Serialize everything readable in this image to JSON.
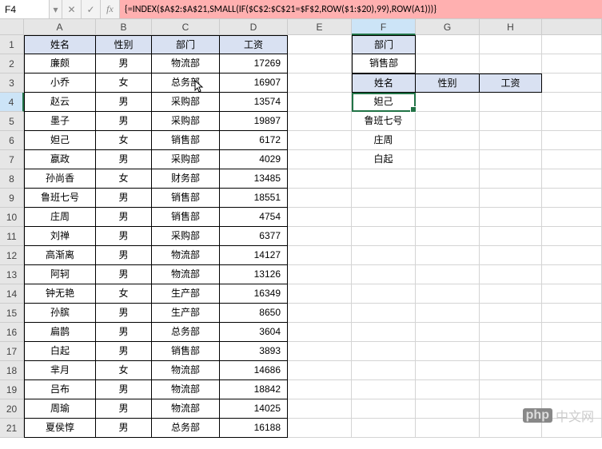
{
  "namebox": "F4",
  "formula": "{=INDEX($A$2:$A$21,SMALL(IF($C$2:$C$21=$F$2,ROW($1:$20),99),ROW(A1)))}",
  "fx_label": "fx",
  "cancel_icon": "✕",
  "confirm_icon": "✓",
  "dropdown_icon": "▾",
  "columns": [
    "A",
    "B",
    "C",
    "D",
    "E",
    "F",
    "G",
    "H",
    ""
  ],
  "main_headers": [
    "姓名",
    "性别",
    "部门",
    "工资"
  ],
  "main_rows": [
    [
      "廉颇",
      "男",
      "物流部",
      "17269"
    ],
    [
      "小乔",
      "女",
      "总务部",
      "16907"
    ],
    [
      "赵云",
      "男",
      "采购部",
      "13574"
    ],
    [
      "墨子",
      "男",
      "采购部",
      "19897"
    ],
    [
      "妲己",
      "女",
      "销售部",
      "6172"
    ],
    [
      "嬴政",
      "男",
      "采购部",
      "4029"
    ],
    [
      "孙尚香",
      "女",
      "财务部",
      "13485"
    ],
    [
      "鲁班七号",
      "男",
      "销售部",
      "18551"
    ],
    [
      "庄周",
      "男",
      "销售部",
      "4754"
    ],
    [
      "刘禅",
      "男",
      "采购部",
      "6377"
    ],
    [
      "高渐离",
      "男",
      "物流部",
      "14127"
    ],
    [
      "阿轲",
      "男",
      "物流部",
      "13126"
    ],
    [
      "钟无艳",
      "女",
      "生产部",
      "16349"
    ],
    [
      "孙膑",
      "男",
      "生产部",
      "8650"
    ],
    [
      "扁鹊",
      "男",
      "总务部",
      "3604"
    ],
    [
      "白起",
      "男",
      "销售部",
      "3893"
    ],
    [
      "芈月",
      "女",
      "物流部",
      "14686"
    ],
    [
      "吕布",
      "男",
      "物流部",
      "18842"
    ],
    [
      "周瑜",
      "男",
      "物流部",
      "14025"
    ],
    [
      "夏侯惇",
      "男",
      "总务部",
      "16188"
    ]
  ],
  "side": {
    "f1": "部门",
    "f2": "销售部",
    "f3": "姓名",
    "g3": "性别",
    "h3": "工资",
    "f4": "妲己",
    "f5": "鲁班七号",
    "f6": "庄周",
    "f7": "白起"
  },
  "watermark": {
    "p": "php",
    "t": "中文网"
  }
}
